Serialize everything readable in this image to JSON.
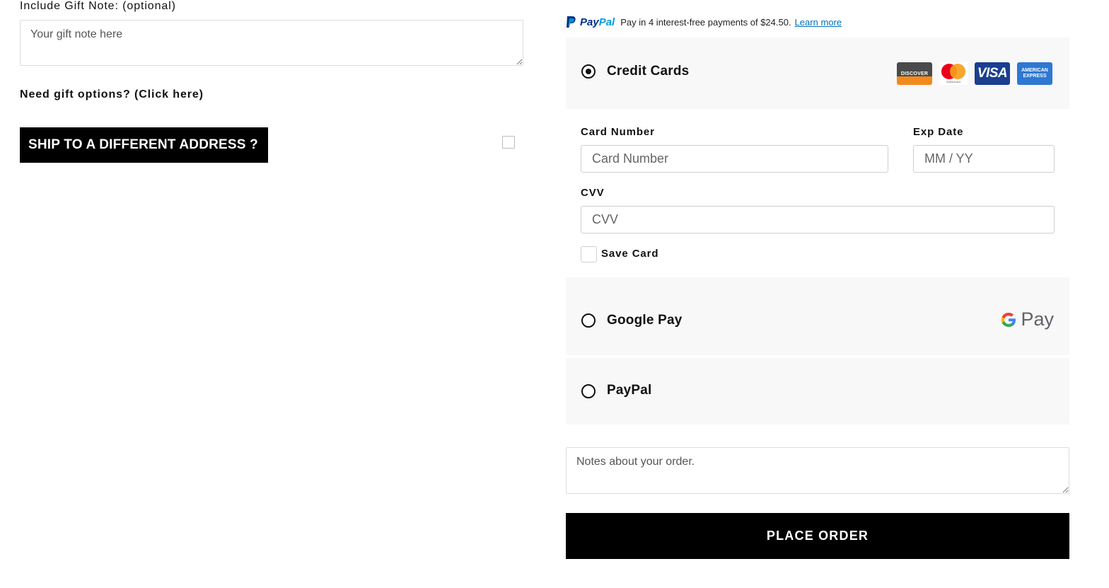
{
  "gift": {
    "label": "Include Gift Note: (optional)",
    "placeholder": "Your gift note here",
    "options_link": "Need gift options? (Click here)"
  },
  "shipping": {
    "button_label": "SHIP TO A DIFFERENT ADDRESS ?"
  },
  "paypal_banner": {
    "brand_a": "Pay",
    "brand_b": "Pal",
    "message": "Pay in 4 interest-free payments of $24.50.",
    "learn_more": "Learn more"
  },
  "payment": {
    "credit_cards": {
      "label": "Credit Cards",
      "selected": true,
      "logos": {
        "discover": "DISCOVER",
        "mastercard": "mastercard",
        "visa": "VISA",
        "amex_line1": "AMERICAN",
        "amex_line2": "EXPRESS"
      },
      "card_number_label": "Card Number",
      "card_number_placeholder": "Card Number",
      "exp_label": "Exp Date",
      "exp_placeholder": "MM / YY",
      "cvv_label": "CVV",
      "cvv_placeholder": "CVV",
      "save_card_label": "Save Card"
    },
    "google_pay": {
      "label": "Google Pay",
      "selected": false,
      "logo_text": "Pay"
    },
    "paypal": {
      "label": "PayPal",
      "selected": false
    }
  },
  "order": {
    "notes_placeholder": "Notes about your order.",
    "place_order_label": "PLACE ORDER"
  },
  "colors": {
    "primary_button": "#000000",
    "panel_bg": "#f8f8f8",
    "paypal_dark": "#003087",
    "paypal_light": "#009cde",
    "link": "#0070ba"
  }
}
